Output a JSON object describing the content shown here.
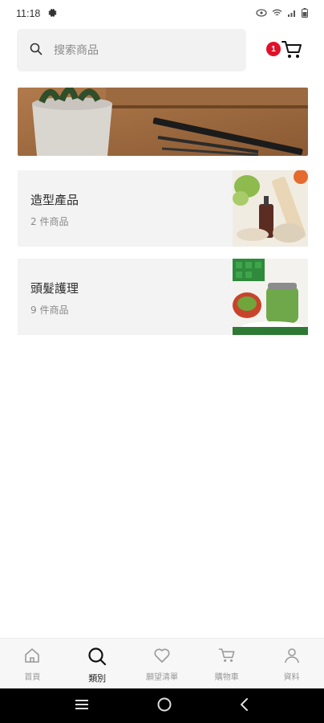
{
  "status_bar": {
    "time": "11:18",
    "gear_icon": "gear-icon",
    "wifi_icon": "wifi-icon",
    "signal_icon": "signal-icon",
    "battery_icon": "battery-icon"
  },
  "search": {
    "placeholder": "搜索商品",
    "value": "",
    "icon": "search-icon"
  },
  "cart": {
    "badge_count": "1",
    "icon": "cart-icon",
    "badge_color": "#e0102a"
  },
  "banner": {
    "image": "banner-image"
  },
  "categories": [
    {
      "name": "造型產品",
      "count": "2 件商品"
    },
    {
      "name": "頭髮護理",
      "count": "9 件商品"
    }
  ],
  "bottom_nav": {
    "items": [
      {
        "label": "首頁",
        "icon": "home-icon",
        "active": false
      },
      {
        "label": "類別",
        "icon": "search-icon",
        "active": true
      },
      {
        "label": "願望清單",
        "icon": "heart-icon",
        "active": false
      },
      {
        "label": "購物車",
        "icon": "cart-icon",
        "active": false
      },
      {
        "label": "資料",
        "icon": "profile-icon",
        "active": false
      }
    ]
  },
  "system_nav": {
    "menu_icon": "menu-icon",
    "home_icon": "home-circle-icon",
    "back_icon": "back-icon"
  }
}
